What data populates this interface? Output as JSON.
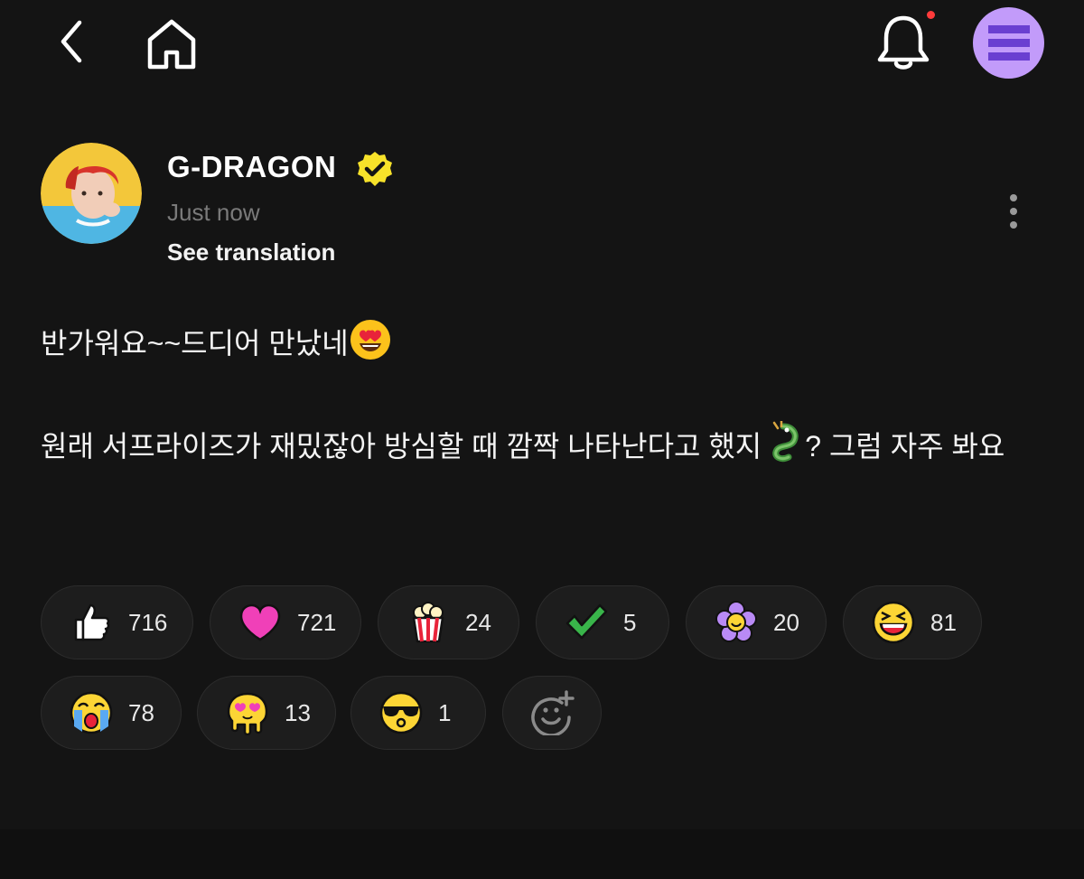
{
  "topbar": {
    "icons": [
      "back-icon",
      "home-icon",
      "bell-icon",
      "menu-icon"
    ],
    "notification_dot_color": "#ff3b3b",
    "menu_bg_color": "#c29bfa"
  },
  "post": {
    "author": "G-DRAGON",
    "verified_badge_color": "#f7e22a",
    "time": "Just now",
    "translate_label": "See translation",
    "line1": "반가워요~~드디어 만났네",
    "line2": "원래 서프라이즈가 재밌잖아 방심할 때 깜짝 나타난다고 했지",
    "line2_end": "? 그럼 자주 봐요"
  },
  "reactions": [
    {
      "icon": "thumbs-up-icon",
      "count": "716"
    },
    {
      "icon": "heart-icon",
      "count": "721"
    },
    {
      "icon": "popcorn-icon",
      "count": "24"
    },
    {
      "icon": "checkmark-icon",
      "count": "5"
    },
    {
      "icon": "flower-icon",
      "count": "20"
    },
    {
      "icon": "laughing-face-icon",
      "count": "81"
    },
    {
      "icon": "crying-face-icon",
      "count": "78"
    },
    {
      "icon": "melting-heart-eyes-icon",
      "count": "13"
    },
    {
      "icon": "sunglasses-face-icon",
      "count": "1"
    }
  ],
  "add_reaction_icon": "add-reaction-icon"
}
